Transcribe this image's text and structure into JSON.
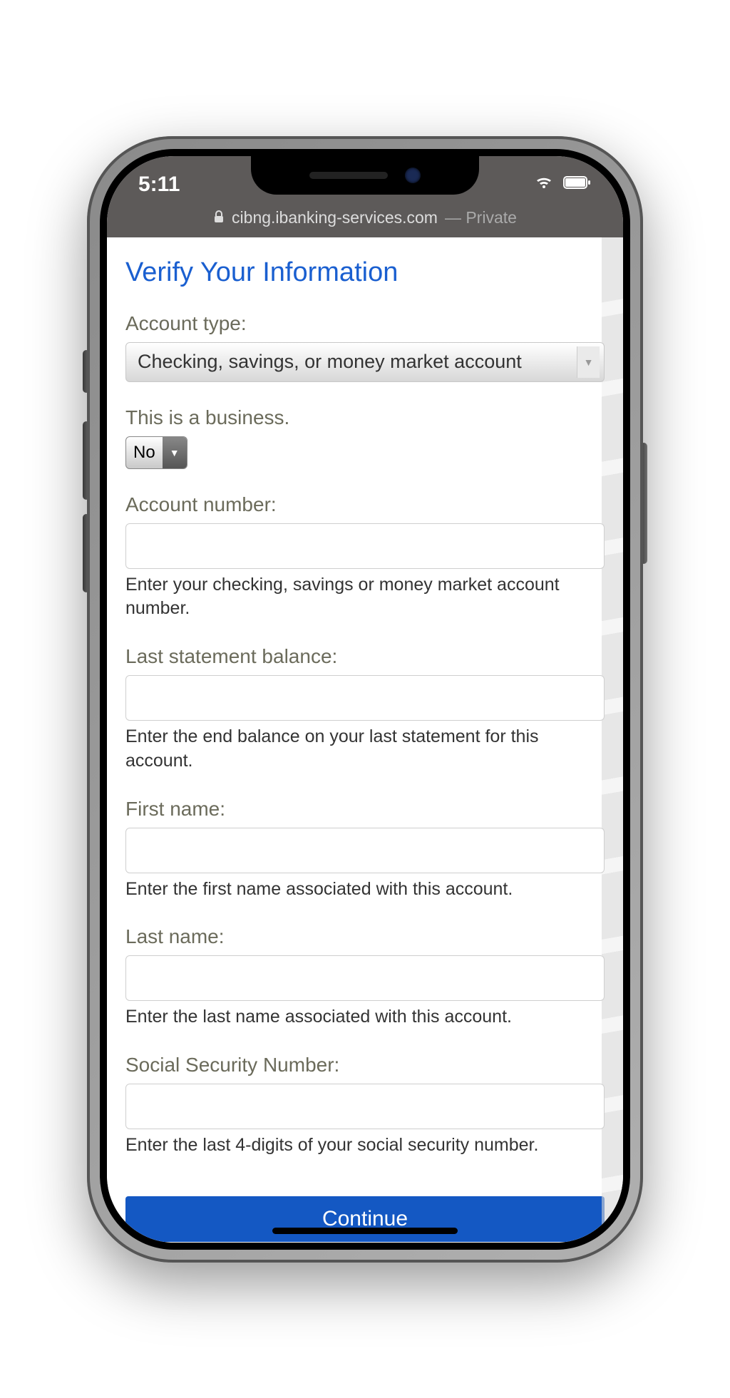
{
  "status": {
    "time": "5:11",
    "url_host": "cibng.ibanking-services.com",
    "url_suffix": " — Private"
  },
  "page": {
    "title": "Verify Your Information"
  },
  "form": {
    "account_type": {
      "label": "Account type:",
      "value": "Checking, savings, or money market account"
    },
    "business": {
      "label": "This is a business.",
      "value": "No"
    },
    "account_number": {
      "label": "Account number:",
      "help": "Enter your checking, savings or money market account number."
    },
    "last_balance": {
      "label": "Last statement balance:",
      "help": "Enter the end balance on your last statement for this account."
    },
    "first_name": {
      "label": "First name:",
      "help": "Enter the first name associated with this account."
    },
    "last_name": {
      "label": "Last name:",
      "help": "Enter the last name associated with this account."
    },
    "ssn": {
      "label": "Social Security Number:",
      "help": "Enter the last 4-digits of your social security number."
    },
    "continue_label": "Continue"
  }
}
